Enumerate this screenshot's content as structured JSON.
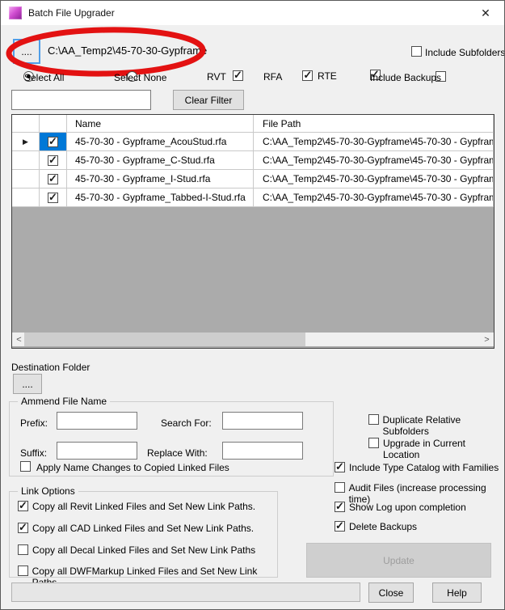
{
  "window": {
    "title": "Batch File Upgrader"
  },
  "icons": {
    "close": "✕",
    "row_arrow": "▶",
    "scroll_left": "<",
    "scroll_right": ">"
  },
  "source": {
    "browse_label": "....",
    "path": "C:\\AA_Temp2\\45-70-30-Gypframe",
    "include_subfolders": {
      "label": "Include Subfolders",
      "checked": false
    }
  },
  "selection_row": {
    "select_all": {
      "label": "Select All",
      "selected": true
    },
    "select_none": {
      "label": "Select None",
      "selected": false
    },
    "file_types": [
      {
        "label": "RVT",
        "checked": true
      },
      {
        "label": "RFA",
        "checked": true
      },
      {
        "label": "RTE",
        "checked": true
      }
    ],
    "include_backups": {
      "label": "Include Backups",
      "checked": false
    }
  },
  "filter": {
    "value": "",
    "clear_button": "Clear Filter"
  },
  "grid": {
    "columns": {
      "name": "Name",
      "file_path": "File Path"
    },
    "rows": [
      {
        "selected": true,
        "checked": true,
        "name": "45-70-30 - Gypframe_AcouStud.rfa",
        "file_path": "C:\\AA_Temp2\\45-70-30-Gypframe\\45-70-30 - Gypfram"
      },
      {
        "selected": false,
        "checked": true,
        "name": "45-70-30 - Gypframe_C-Stud.rfa",
        "file_path": "C:\\AA_Temp2\\45-70-30-Gypframe\\45-70-30 - Gypfram"
      },
      {
        "selected": false,
        "checked": true,
        "name": "45-70-30 - Gypframe_I-Stud.rfa",
        "file_path": "C:\\AA_Temp2\\45-70-30-Gypframe\\45-70-30 - Gypfram"
      },
      {
        "selected": false,
        "checked": true,
        "name": "45-70-30 - Gypframe_Tabbed-I-Stud.rfa",
        "file_path": "C:\\AA_Temp2\\45-70-30-Gypframe\\45-70-30 - Gypfram"
      }
    ]
  },
  "destination": {
    "label": "Destination Folder",
    "browse_label": "...."
  },
  "amend_group": {
    "title": "Ammend File Name",
    "prefix_label": "Prefix:",
    "suffix_label": "Suffix:",
    "search_label": "Search For:",
    "replace_label": "Replace With:",
    "prefix_value": "",
    "suffix_value": "",
    "search_value": "",
    "replace_value": "",
    "apply_checkbox": {
      "label": "Apply Name Changes to Copied Linked Files",
      "checked": false
    }
  },
  "options": [
    {
      "label": "Duplicate Relative Subfolders",
      "checked": false
    },
    {
      "label": "Upgrade in Current Location",
      "checked": false
    },
    {
      "label": "Include Type Catalog with Families",
      "checked": true
    },
    {
      "label": "Audit Files (increase processing time)",
      "checked": false
    },
    {
      "label": "Show Log upon completion",
      "checked": true
    },
    {
      "label": "Delete Backups",
      "checked": true
    }
  ],
  "link_options": {
    "title": "Link Options",
    "items": [
      {
        "label": "Copy all Revit Linked Files and Set New Link Paths.",
        "checked": true
      },
      {
        "label": "Copy all CAD Linked Files and Set New Link Paths.",
        "checked": true
      },
      {
        "label": "Copy all Decal Linked Files and Set New Link Paths",
        "checked": false
      },
      {
        "label": "Copy all DWFMarkup Linked Files and Set New Link Paths.",
        "checked": false
      }
    ]
  },
  "actions": {
    "update": "Update",
    "close": "Close",
    "help": "Help",
    "status_value": ""
  },
  "colors": {
    "accent_selection": "#0078d7",
    "annotation_red": "#e31212",
    "grid_empty": "#ababab"
  }
}
